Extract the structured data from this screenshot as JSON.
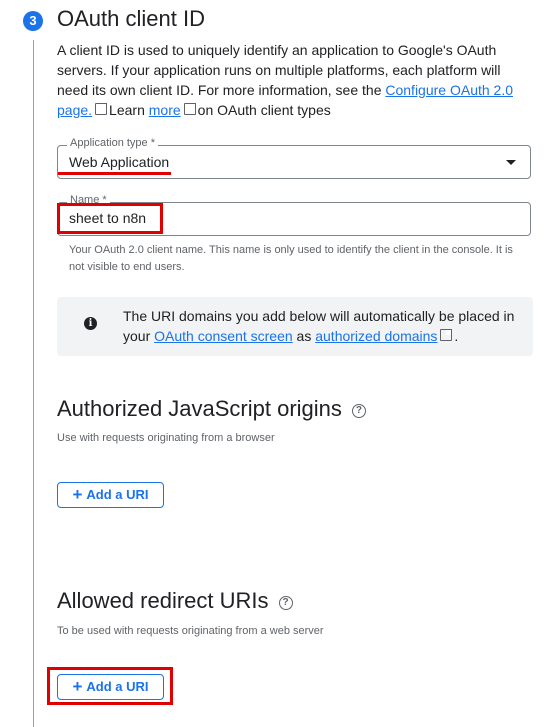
{
  "step": {
    "number": "3",
    "title": "OAuth client ID",
    "description_main": "A client ID is used to uniquely identify an application to Google's OAuth servers. If your application runs on multiple platforms, each platform will need its own client ID. For more information, see the ",
    "configure_link": "Configure OAuth 2.0 page.",
    "learn_text": "Learn ",
    "more_link": "more",
    "description_end": "on OAuth client types"
  },
  "application_type": {
    "label": "Application type *",
    "value": "Web Application"
  },
  "name": {
    "label": "Name *",
    "value": "sheet to n8n",
    "hint": "Your OAuth 2.0 client name. This name is only used to identify the client in the console. It is not visible to end users."
  },
  "info": {
    "text_start": "The URI domains you add below will automatically be placed in your ",
    "consent_link": "OAuth consent screen",
    "text_mid": " as ",
    "domains_link": "authorized domains",
    "text_end": "."
  },
  "js_origins": {
    "title": "Authorized JavaScript origins",
    "description": "Use with requests originating from a browser",
    "button": "Add a URI"
  },
  "redirect_uris": {
    "title": "Allowed redirect URIs",
    "description": "To be used with requests originating from a web server",
    "button": "Add a URI"
  },
  "colors": {
    "accent": "#1a73e8",
    "highlight": "#e00000"
  },
  "icons": [
    "external-link-icon",
    "dropdown-caret-icon",
    "info-icon",
    "help-icon",
    "plus-icon"
  ]
}
